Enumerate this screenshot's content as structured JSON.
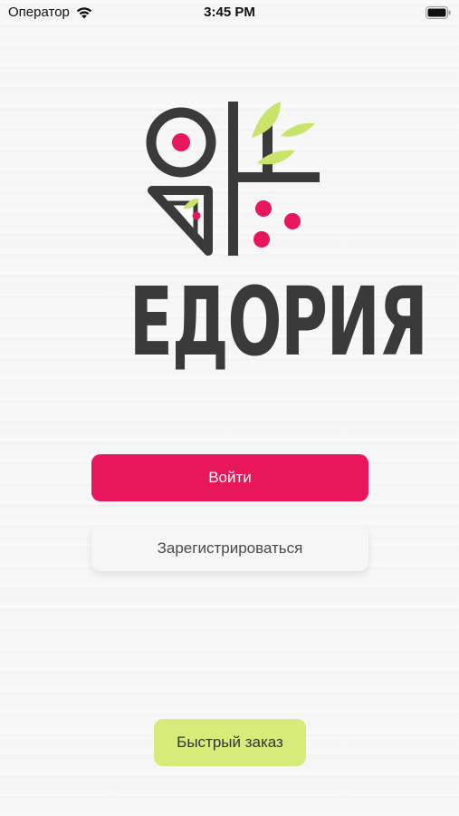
{
  "status_bar": {
    "carrier": "Оператор",
    "time": "3:45 PM",
    "icons": [
      "wifi-icon",
      "battery-icon"
    ]
  },
  "brand": {
    "name": "ЕДОРИЯ",
    "colors": {
      "dark": "#3a3a3a",
      "accent": "#e8175b",
      "leaf": "#c9e36b"
    }
  },
  "actions": {
    "login_label": "Войти",
    "register_label": "Зарегистрироваться",
    "quick_order_label": "Быстрый заказ"
  },
  "colors": {
    "login_button": "#e8175b",
    "register_button": "#f6f6f6",
    "quick_order_button": "#d5ec7a"
  }
}
